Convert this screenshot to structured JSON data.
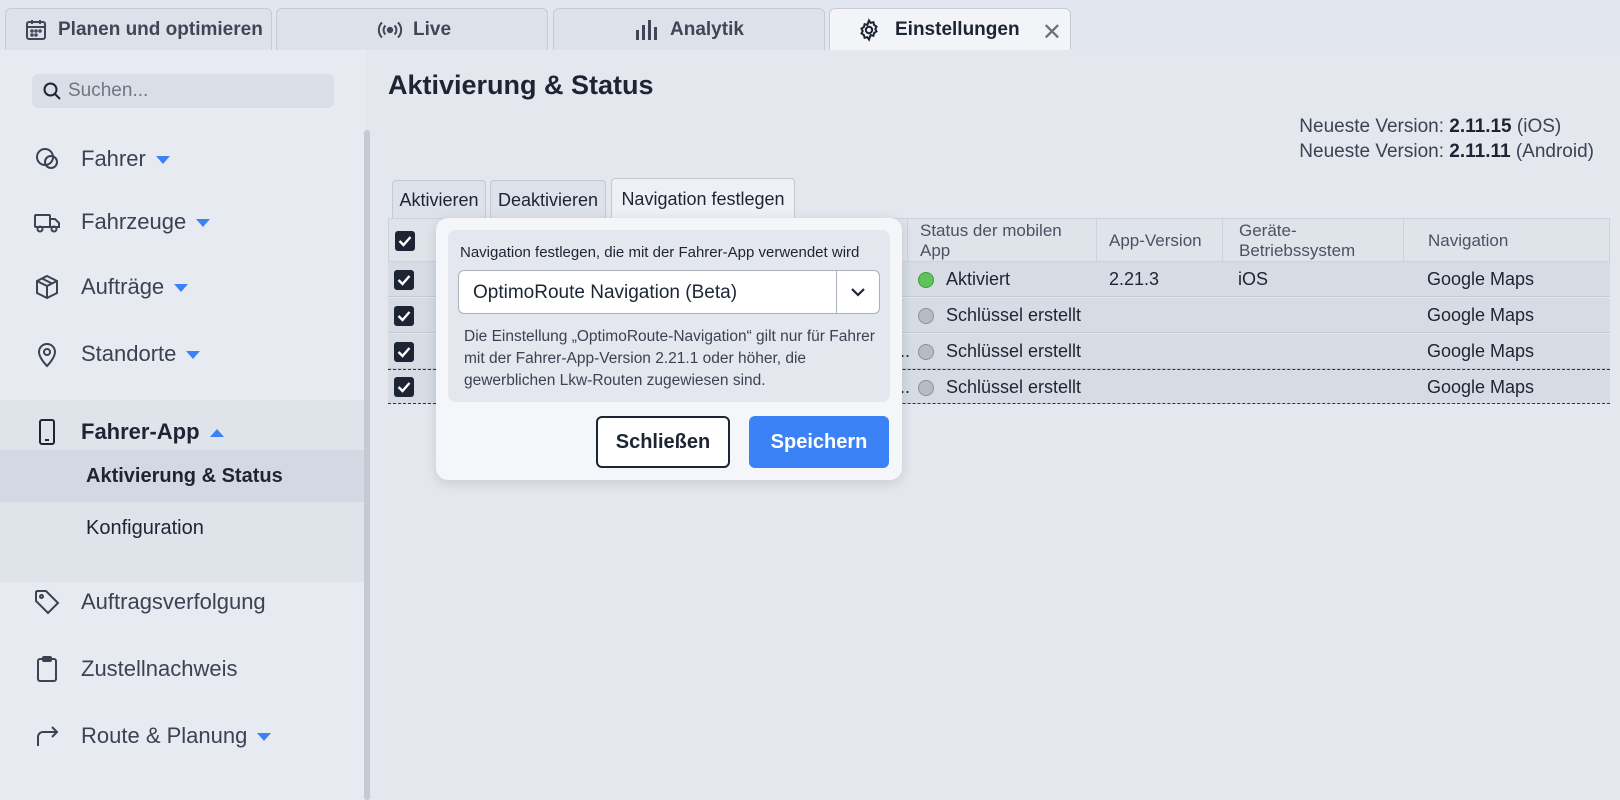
{
  "top_tabs": [
    {
      "label": "Planen und optimieren",
      "icon": "calendar-icon",
      "active": false
    },
    {
      "label": "Live",
      "icon": "broadcast-icon",
      "active": false
    },
    {
      "label": "Analytik",
      "icon": "bar-chart-icon",
      "active": false
    },
    {
      "label": "Einstellungen",
      "icon": "gear-icon",
      "active": true
    }
  ],
  "sidebar": {
    "search_placeholder": "Suchen...",
    "items": [
      {
        "label": "Fahrer",
        "icon": "driver-icon",
        "expandable": true
      },
      {
        "label": "Fahrzeuge",
        "icon": "truck-icon",
        "expandable": true
      },
      {
        "label": "Aufträge",
        "icon": "box-icon",
        "expandable": true
      },
      {
        "label": "Standorte",
        "icon": "location-pin-icon",
        "expandable": true
      },
      {
        "label": "Fahrer-App",
        "icon": "phone-icon",
        "expanded": true
      },
      {
        "label": "Auftragsverfolgung",
        "icon": "tag-icon"
      },
      {
        "label": "Zustellnachweis",
        "icon": "clipboard-icon"
      },
      {
        "label": "Route & Planung",
        "icon": "route-arrow-icon",
        "expandable": true
      }
    ],
    "subitems": [
      {
        "label": "Aktivierung & Status",
        "active": true
      },
      {
        "label": "Konfiguration",
        "active": false
      }
    ]
  },
  "main": {
    "title": "Aktivierung & Status",
    "versions": [
      {
        "prefix": "Neueste Version:",
        "version": "2.11.15",
        "platform": "(iOS)"
      },
      {
        "prefix": "Neueste Version:",
        "version": "2.11.11",
        "platform": "(Android)"
      }
    ],
    "subtabs": [
      "Aktivieren",
      "Deaktivieren",
      "Navigation festlegen"
    ],
    "table": {
      "columns": [
        "Status der mobilen App",
        "App-Version",
        "Geräte-Betriebssystem",
        "Navigation"
      ],
      "rows": [
        {
          "fragment": "",
          "status": "Aktiviert",
          "status_color": "green",
          "app_version": "2.21.3",
          "os": "iOS",
          "navigation": "Google Maps"
        },
        {
          "fragment": "/...",
          "status": "Schlüssel erstellt",
          "status_color": "gray",
          "app_version": "",
          "os": "",
          "navigation": "Google Maps"
        },
        {
          "fragment": "S...",
          "status": "Schlüssel erstellt",
          "status_color": "gray",
          "app_version": "",
          "os": "",
          "navigation": "Google Maps"
        },
        {
          "fragment": "S...",
          "status": "Schlüssel erstellt",
          "status_color": "gray",
          "app_version": "",
          "os": "",
          "navigation": "Google Maps"
        }
      ]
    }
  },
  "popover": {
    "label": "Navigation festlegen, die mit der Fahrer-App verwendet wird",
    "selected_value": "OptimoRoute Navigation (Beta)",
    "help_text": "Die Einstellung „OptimoRoute-Navigation“ gilt nur für Fahrer mit der Fahrer-App-Version 2.21.1 oder höher, die gewerblichen Lkw-Routen zugewiesen sind.",
    "close_label": "Schließen",
    "save_label": "Speichern"
  },
  "colors": {
    "accent": "#3b82f6",
    "status_green": "#5ec45a",
    "status_gray": "#b6bac2"
  }
}
